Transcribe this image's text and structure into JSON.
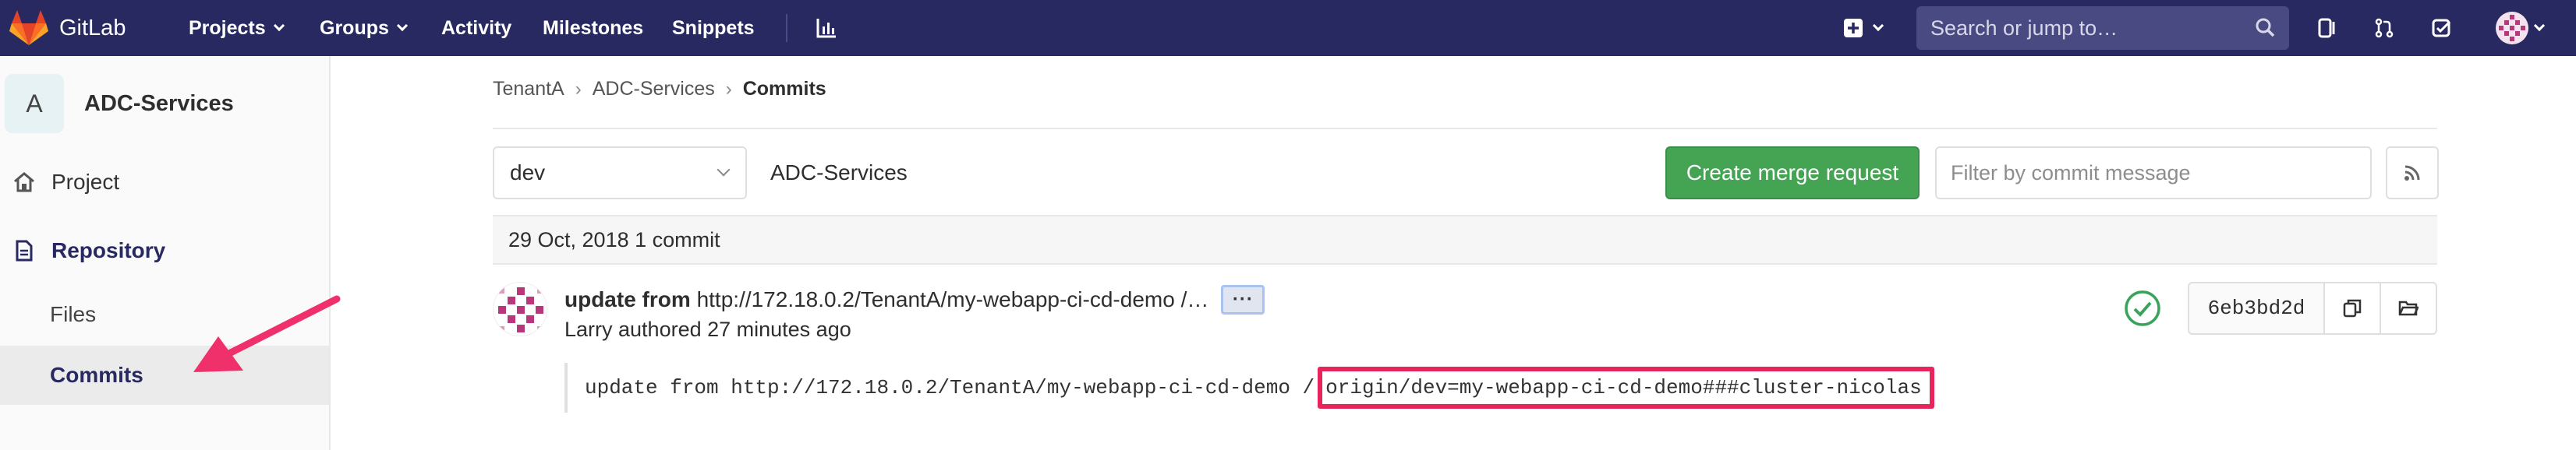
{
  "navbar": {
    "brand": "GitLab",
    "menu": [
      "Projects",
      "Groups",
      "Activity",
      "Milestones",
      "Snippets"
    ],
    "search_placeholder": "Search or jump to…"
  },
  "sidebar": {
    "avatar_letter": "A",
    "project_name": "ADC-Services",
    "items": {
      "project": "Project",
      "repository": "Repository",
      "files": "Files",
      "commits": "Commits"
    }
  },
  "breadcrumb": {
    "group": "TenantA",
    "project": "ADC-Services",
    "current": "Commits"
  },
  "toolbar": {
    "branch": "dev",
    "repo_label": "ADC-Services",
    "merge_button": "Create merge request",
    "filter_placeholder": "Filter by commit message"
  },
  "commits_day": "29 Oct, 2018 1 commit",
  "commit": {
    "title_bold": "update from",
    "title_rest": "http://172.18.0.2/TenantA/my-webapp-ci-cd-demo /…",
    "ellipsis": "···",
    "author_line": "Larry authored 27 minutes ago",
    "sha": "6eb3bd2d",
    "desc_prefix": "update from http://172.18.0.2/TenantA/my-webapp-ci-cd-demo /",
    "desc_highlight": "origin/dev=my-webapp-ci-cd-demo###cluster-nicolas"
  },
  "colors": {
    "navbar": "#292961",
    "merge_button": "#44a454",
    "highlight_box": "#e8245d",
    "annotation_arrow": "#f0306a"
  }
}
